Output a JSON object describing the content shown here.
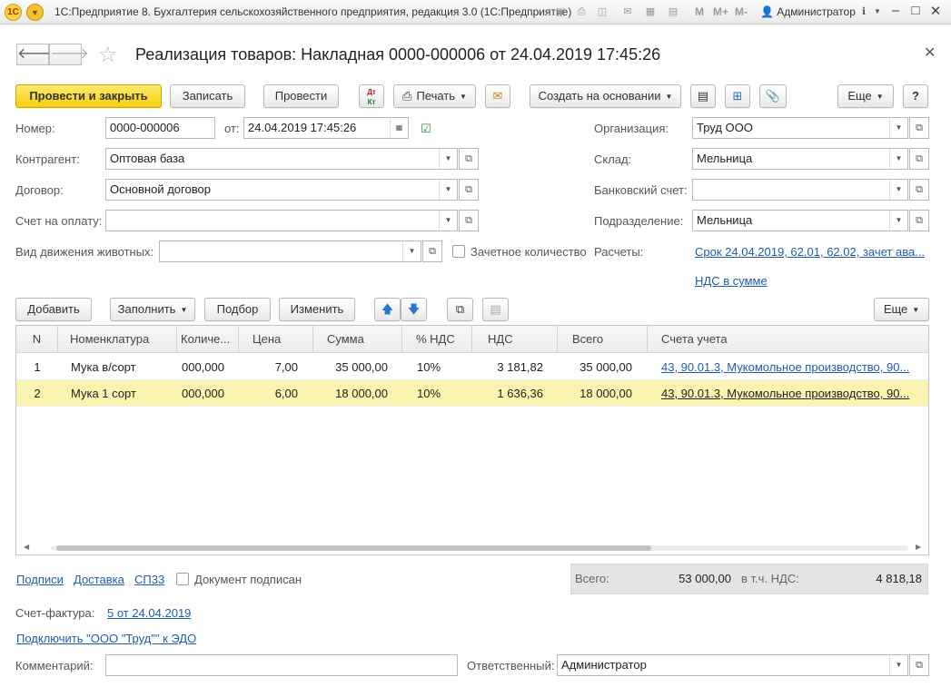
{
  "window": {
    "title": "1С:Предприятие 8. Бухгалтерия сельскохозяйственного предприятия, редакция 3.0  (1С:Предприятие)",
    "user": "Администратор",
    "m_buttons": [
      "M",
      "M+",
      "M-"
    ]
  },
  "document": {
    "title": "Реализация товаров: Накладная 0000-000006 от 24.04.2019 17:45:26"
  },
  "toolbar": {
    "post_close": "Провести и закрыть",
    "save": "Записать",
    "post": "Провести",
    "dtkt": "Дт Кт",
    "print": "Печать",
    "create_based": "Создать на основании",
    "more": "Еще",
    "help": "?"
  },
  "form": {
    "number_label": "Номер:",
    "number_value": "0000-000006",
    "date_label": "от:",
    "date_value": "24.04.2019 17:45:26",
    "counterparty_label": "Контрагент:",
    "counterparty_value": "Оптовая база",
    "contract_label": "Договор:",
    "contract_value": "Основной договор",
    "invoice_label": "Счет на оплату:",
    "invoice_value": "",
    "animal_label": "Вид движения животных:",
    "animal_value": "",
    "credit_qty_label": "Зачетное количество",
    "org_label": "Организация:",
    "org_value": "Труд ООО",
    "warehouse_label": "Склад:",
    "warehouse_value": "Мельница",
    "bank_label": "Банковский счет:",
    "bank_value": "",
    "dept_label": "Подразделение:",
    "dept_value": "Мельница",
    "settlements_label": "Расчеты:",
    "settlements_link": "Срок 24.04.2019, 62.01, 62.02, зачет ава...",
    "vat_link": "НДС в сумме"
  },
  "table_toolbar": {
    "add": "Добавить",
    "fill": "Заполнить",
    "pick": "Подбор",
    "change": "Изменить",
    "more": "Еще"
  },
  "table": {
    "columns": [
      "N",
      "Номенклатура",
      "Количе...",
      "Цена",
      "Сумма",
      "% НДС",
      "НДС",
      "Всего",
      "Счета учета"
    ],
    "rows": [
      {
        "n": "1",
        "item": "Мука в/сорт",
        "qty": "000,000",
        "price": "7,00",
        "sum": "35 000,00",
        "vat_rate": "10%",
        "vat": "3 181,82",
        "total": "35 000,00",
        "accounts": "43, 90.01.3, Мукомольное производство, 90..."
      },
      {
        "n": "2",
        "item": "Мука 1 сорт",
        "qty": "000,000",
        "price": "6,00",
        "sum": "18 000,00",
        "vat_rate": "10%",
        "vat": "1 636,36",
        "total": "18 000,00",
        "accounts": "43, 90.01.3, Мукомольное производство, 90..."
      }
    ]
  },
  "footer": {
    "signatures": "Подписи",
    "delivery": "Доставка",
    "sp33": "СП33",
    "signed": "Документ подписан",
    "total_label": "Всего:",
    "total_value": "53 000,00",
    "vat_label": "в т.ч. НДС:",
    "vat_value": "4 818,18",
    "invoice_label": "Счет-фактура:",
    "invoice_link": "5 от 24.04.2019",
    "edo_link": "Подключить \"ООО \"Труд\"\" к ЭДО",
    "comment_label": "Комментарий:",
    "comment_value": "",
    "responsible_label": "Ответственный:",
    "responsible_value": "Администратор"
  }
}
